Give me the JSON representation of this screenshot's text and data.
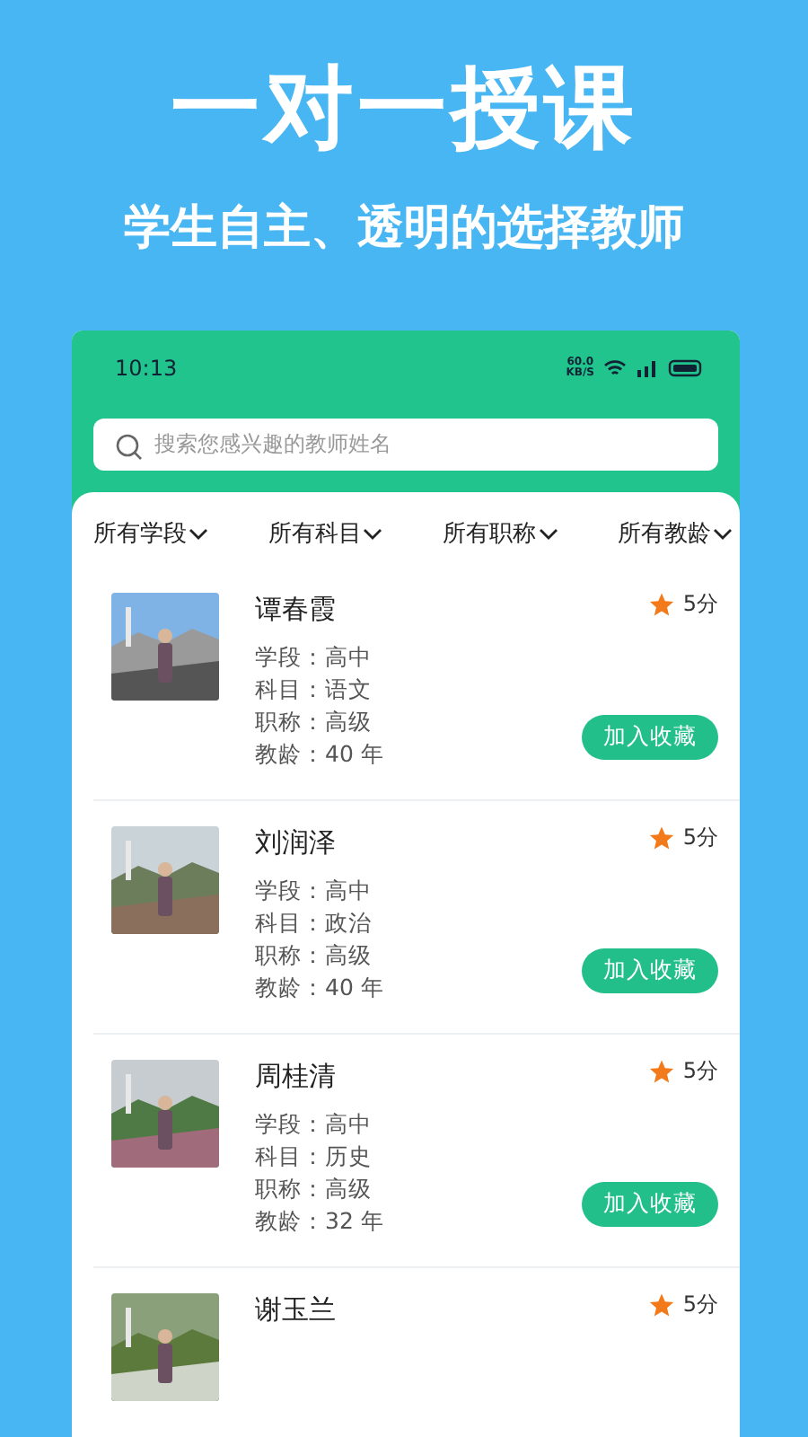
{
  "headline": "一对一授课",
  "subheadline": "学生自主、透明的选择教师",
  "status_bar": {
    "time": "10:13",
    "net_speed": [
      "60.0",
      "KB/S"
    ]
  },
  "search": {
    "placeholder": "搜索您感兴趣的教师姓名"
  },
  "filters": [
    {
      "label": "所有学段"
    },
    {
      "label": "所有科目"
    },
    {
      "label": "所有职称"
    },
    {
      "label": "所有教龄"
    }
  ],
  "teachers": [
    {
      "name": "谭春霞",
      "rating": "5分",
      "details": [
        "学段：高中",
        "科目：语文",
        "职称：高级",
        "教龄：40 年"
      ],
      "button": "加入收藏"
    },
    {
      "name": "刘润泽",
      "rating": "5分",
      "details": [
        "学段：高中",
        "科目：政治",
        "职称：高级",
        "教龄：40 年"
      ],
      "button": "加入收藏"
    },
    {
      "name": "周桂清",
      "rating": "5分",
      "details": [
        "学段：高中",
        "科目：历史",
        "职称：高级",
        "教龄：32 年"
      ],
      "button": "加入收藏"
    },
    {
      "name": "谢玉兰",
      "rating": "5分"
    }
  ]
}
